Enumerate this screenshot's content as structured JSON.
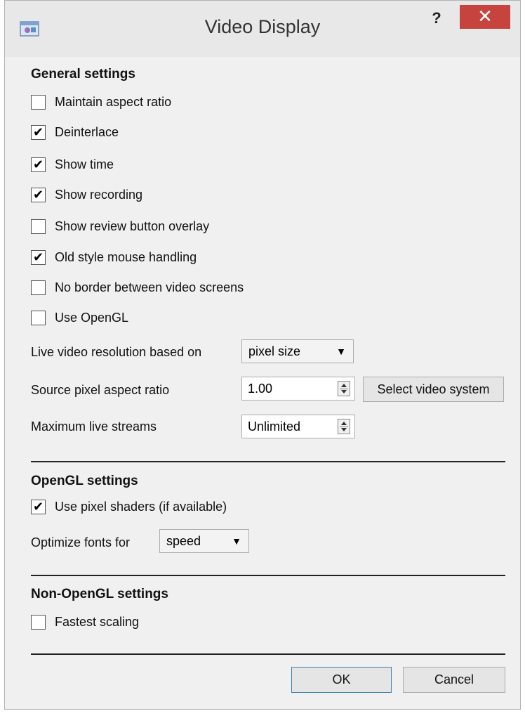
{
  "window": {
    "title": "Video Display",
    "help_label": "?",
    "close_label": "✕"
  },
  "general": {
    "heading": "General settings",
    "checks": [
      {
        "label": "Maintain aspect ratio",
        "checked": false
      },
      {
        "label": "Deinterlace",
        "checked": true
      },
      {
        "label": "Show time",
        "checked": true
      },
      {
        "label": "Show recording",
        "checked": true
      },
      {
        "label": "Show review button overlay",
        "checked": false
      },
      {
        "label": "Old style mouse handling",
        "checked": true
      },
      {
        "label": "No border between video screens",
        "checked": false
      },
      {
        "label": "Use OpenGL",
        "checked": false
      }
    ],
    "live_res_label": "Live video resolution based on",
    "live_res_value": "pixel size",
    "aspect_label": "Source pixel aspect ratio",
    "aspect_value": "1.00",
    "select_system_label": "Select video system",
    "max_streams_label": "Maximum live streams",
    "max_streams_value": "Unlimited"
  },
  "opengl": {
    "heading": "OpenGL settings",
    "pixel_shaders_label": "Use pixel shaders (if available)",
    "pixel_shaders_checked": true,
    "optimize_label": "Optimize fonts for",
    "optimize_value": "speed"
  },
  "non_opengl": {
    "heading": "Non-OpenGL settings",
    "fastest_label": "Fastest scaling",
    "fastest_checked": false
  },
  "buttons": {
    "ok": "OK",
    "cancel": "Cancel"
  },
  "glyphs": {
    "check": "✔",
    "dropdown": "▼"
  }
}
